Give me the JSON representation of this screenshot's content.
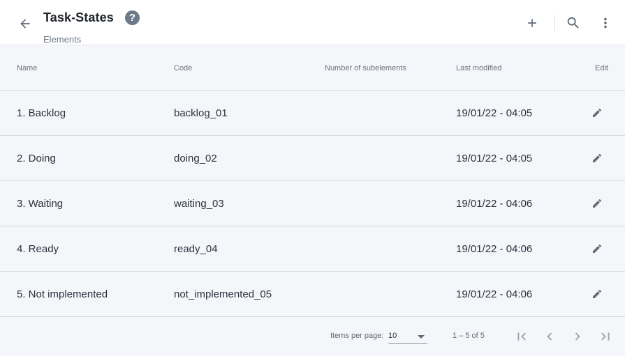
{
  "header": {
    "title": "Task-States",
    "subtitle": "Elements",
    "help_glyph": "?",
    "icons": [
      "back-arrow-icon",
      "help-icon",
      "plus-icon",
      "search-icon",
      "more-vert-icon"
    ]
  },
  "table": {
    "columns": {
      "name": "Name",
      "code": "Code",
      "subelements": "Number of subelements",
      "modified": "Last modified",
      "edit": "Edit"
    },
    "rows": [
      {
        "name": "1. Backlog",
        "code": "backlog_01",
        "subelements": "",
        "modified": "19/01/22 - 04:05"
      },
      {
        "name": "2. Doing",
        "code": "doing_02",
        "subelements": "",
        "modified": "19/01/22 - 04:05"
      },
      {
        "name": "3. Waiting",
        "code": "waiting_03",
        "subelements": "",
        "modified": "19/01/22 - 04:06"
      },
      {
        "name": "4. Ready",
        "code": "ready_04",
        "subelements": "",
        "modified": "19/01/22 - 04:06"
      },
      {
        "name": "5. Not implemented",
        "code": "not_implemented_05",
        "subelements": "",
        "modified": "19/01/22 - 04:06"
      }
    ]
  },
  "paginator": {
    "items_per_page_label": "Items per page:",
    "items_per_page_value": "10",
    "range_label": "1 – 5 of 5"
  },
  "colors": {
    "background": "#f4f6f9",
    "header_bg": "#ffffff",
    "icon": "#5f6a77",
    "help_badge": "#6c7989",
    "divider": "#d7dbe0"
  }
}
